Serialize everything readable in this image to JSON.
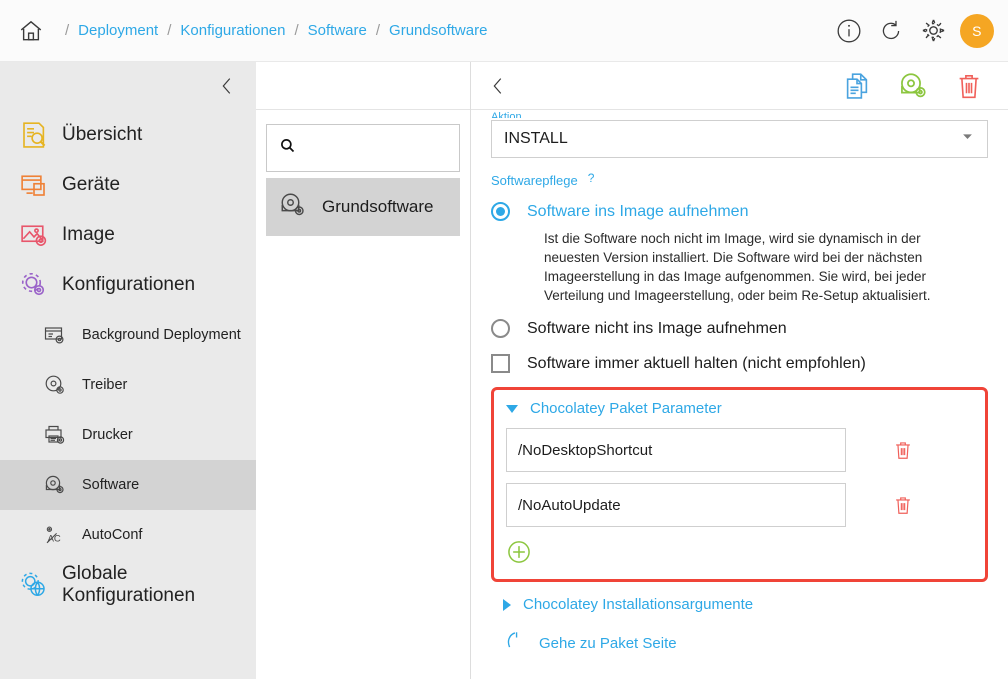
{
  "header": {
    "home_icon": "home-icon",
    "breadcrumbs": [
      {
        "label": "Deployment"
      },
      {
        "label": "Konfigurationen"
      },
      {
        "label": "Software"
      },
      {
        "label": "Grundsoftware"
      }
    ],
    "separator": "/",
    "actions": [
      {
        "name": "info-icon",
        "label": "i"
      },
      {
        "name": "refresh-icon",
        "label": ""
      },
      {
        "name": "gear-icon",
        "label": ""
      }
    ],
    "avatar_initial": "S",
    "avatar_color": "#f5a623"
  },
  "sidebar": {
    "collapse_icon": "chevron-left-icon",
    "items": [
      {
        "label": "Übersicht",
        "icon": "overview-icon",
        "level": 0,
        "active": false
      },
      {
        "label": "Geräte",
        "icon": "devices-icon",
        "level": 0,
        "active": false
      },
      {
        "label": "Image",
        "icon": "image-icon",
        "level": 0,
        "active": false
      },
      {
        "label": "Konfigurationen",
        "icon": "configurations-icon",
        "level": 0,
        "active": false
      },
      {
        "label": "Background Deployment",
        "icon": "background-deployment-icon",
        "level": 1,
        "active": false
      },
      {
        "label": "Treiber",
        "icon": "driver-icon",
        "level": 1,
        "active": false
      },
      {
        "label": "Drucker",
        "icon": "printer-icon",
        "level": 1,
        "active": false
      },
      {
        "label": "Software",
        "icon": "software-icon",
        "level": 1,
        "active": true
      },
      {
        "label": "AutoConf",
        "icon": "autoconf-icon",
        "level": 1,
        "active": false
      },
      {
        "label": "Globale Konfigurationen",
        "icon": "global-configurations-icon",
        "level": 0,
        "active": false
      }
    ]
  },
  "midpanel": {
    "search": {
      "value": "",
      "placeholder": "",
      "icon": "search-icon"
    },
    "list": [
      {
        "label": "Grundsoftware",
        "icon": "software-icon",
        "selected": true
      }
    ]
  },
  "mainpanel": {
    "back_icon": "chevron-left-icon",
    "tools": [
      {
        "name": "copy-document-icon",
        "color": "#4aa3df"
      },
      {
        "name": "software-package-icon",
        "color": "#8cc63f"
      },
      {
        "name": "delete-icon",
        "color": "#f0605a"
      }
    ],
    "clipped_label": "Aktion",
    "action_select": {
      "value": "INSTALL",
      "caret": "chevron-down-icon"
    },
    "maintenance": {
      "label": "Softwarepflege",
      "help": "?",
      "options": [
        {
          "label": "Software ins Image aufnehmen",
          "selected": true
        },
        {
          "label": "Software nicht ins Image aufnehmen",
          "selected": false
        }
      ],
      "description": "Ist die Software noch nicht im Image, wird sie dynamisch in der neuesten Version installiert. Die Software wird bei der nächsten Imageerstellung in das Image aufgenommen. Sie wird, bei jeder Verteilung und Imageerstellung, oder beim Re-Setup aktualisiert.",
      "checkbox": {
        "label": "Software immer aktuell halten (nicht empfohlen)",
        "checked": false
      }
    },
    "package_parameters": {
      "title": "Chocolatey Paket Parameter",
      "expanded": true,
      "highlight_color": "#f04438",
      "values": [
        {
          "value": "/NoDesktopShortcut",
          "delete_icon": "delete-icon"
        },
        {
          "value": "/NoAutoUpdate",
          "delete_icon": "delete-icon"
        }
      ],
      "add_icon": "add-icon"
    },
    "install_arguments": {
      "title": "Chocolatey Installationsargumente",
      "expanded": false
    },
    "package_link": {
      "label": "Gehe zu Paket Seite",
      "icon": "external-link-icon"
    }
  }
}
